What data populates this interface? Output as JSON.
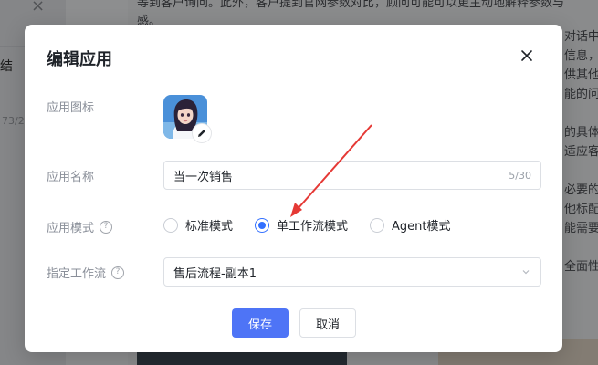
{
  "background": {
    "left_close_glyph": "×",
    "left_text": "结",
    "left_count": "73/2",
    "top_text": "等到客户询问。此外，客户提到官网参数对比，顾问可能可以更主动地解释参数与",
    "top_text_2": "感。",
    "right_lines": [
      "对话中",
      "信息，",
      "供其他",
      "能的问",
      "",
      "的具体",
      "适应客",
      "",
      "必要的",
      "他标配",
      "能需要",
      "",
      "全面性"
    ]
  },
  "dialog": {
    "title": "编辑应用",
    "close_icon": "close-icon",
    "fields": {
      "icon_label": "应用图标",
      "name_label": "应用名称",
      "name_value": "当一次销售",
      "name_counter": "5/30",
      "mode_label": "应用模式",
      "workflow_label": "指定工作流",
      "workflow_value": "售后流程-副本1"
    },
    "modes": [
      {
        "label": "标准模式",
        "checked": false
      },
      {
        "label": "单工作流模式",
        "checked": true
      },
      {
        "label": "Agent模式",
        "checked": false
      }
    ],
    "buttons": {
      "save": "保存",
      "cancel": "取消"
    }
  },
  "colors": {
    "primary": "#4e74f6",
    "radio_checked": "#3370ff",
    "annotation_arrow": "#e53935"
  }
}
